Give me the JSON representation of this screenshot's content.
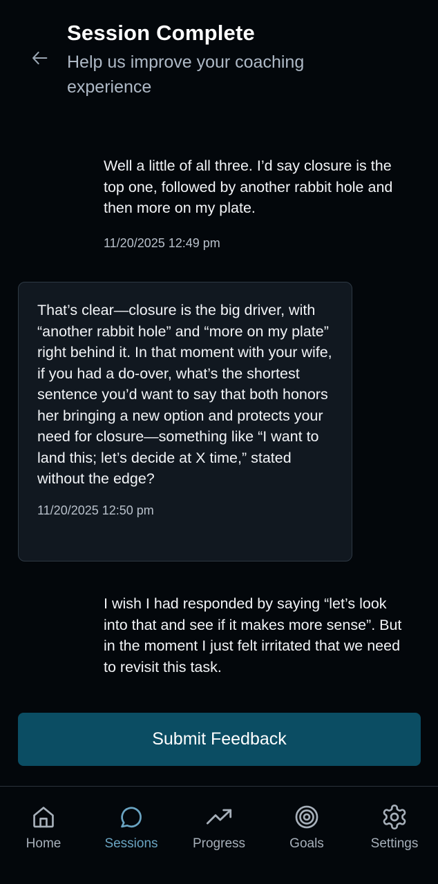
{
  "header": {
    "title": "Session Complete",
    "subtitle": "Help us improve your coaching experience"
  },
  "messages": [
    {
      "role": "user",
      "text": "Well a little of all three. I’d say closure is the top one, followed by another rabbit hole and then more on my plate.",
      "time": "11/20/2025 12:49 pm"
    },
    {
      "role": "coach",
      "text": "That’s clear—closure is the big driver, with “another rabbit hole” and “more on my plate” right behind it. In that moment with your wife, if you had a do-over, what’s the shortest sentence you’d want to say that both honors her bringing a new option and protects your need for closure—something like “I want to land this; let’s decide at X time,” stated without the edge?",
      "time": "11/20/2025 12:50 pm"
    },
    {
      "role": "user",
      "text": "I wish I had responded by saying “let’s look into that and see if it makes more sense”. But in the moment I just felt irritated that we need to revisit this task."
    }
  ],
  "submit": {
    "label": "Submit Feedback"
  },
  "nav": {
    "active": "Sessions",
    "items": [
      {
        "label": "Home",
        "icon": "home-icon"
      },
      {
        "label": "Sessions",
        "icon": "chat-bubble-icon"
      },
      {
        "label": "Progress",
        "icon": "trending-up-icon"
      },
      {
        "label": "Goals",
        "icon": "target-icon"
      },
      {
        "label": "Settings",
        "icon": "gear-icon"
      }
    ]
  },
  "colors": {
    "background": "#03070b",
    "accent": "#0b4d63",
    "active_nav": "#6aa4c2"
  }
}
